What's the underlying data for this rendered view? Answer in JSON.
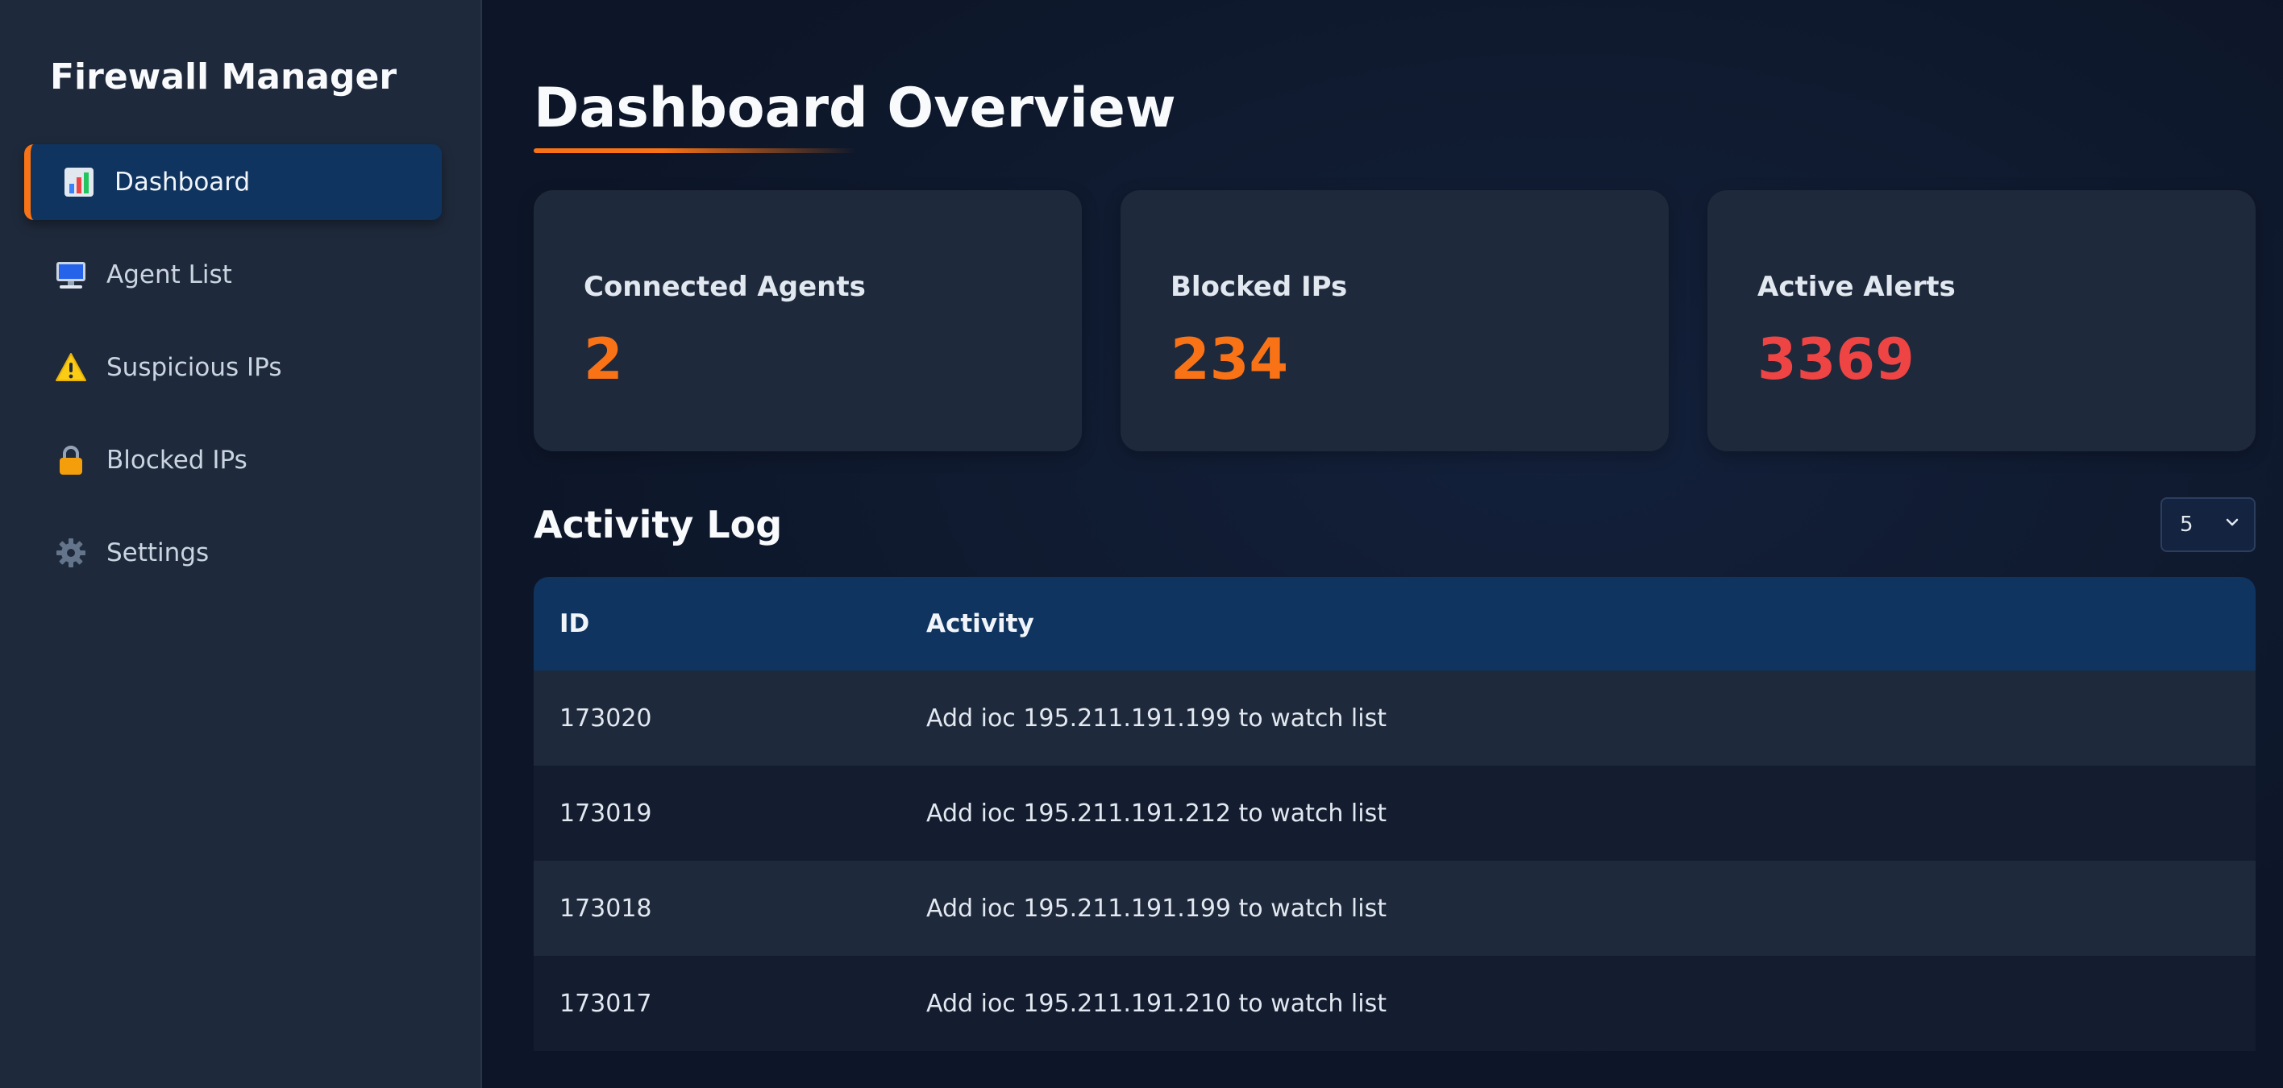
{
  "sidebar": {
    "brand": "Firewall Manager",
    "items": [
      {
        "label": "Dashboard",
        "icon": "bar-chart-icon"
      },
      {
        "label": "Agent List",
        "icon": "monitor-icon"
      },
      {
        "label": "Suspicious IPs",
        "icon": "warning-icon"
      },
      {
        "label": "Blocked IPs",
        "icon": "lock-icon"
      },
      {
        "label": "Settings",
        "icon": "gear-icon"
      }
    ],
    "active_index": 0
  },
  "main": {
    "title": "Dashboard Overview",
    "stats": [
      {
        "label": "Connected Agents",
        "value": "2",
        "color": "#f97316"
      },
      {
        "label": "Blocked IPs",
        "value": "234",
        "color": "#f97316"
      },
      {
        "label": "Active Alerts",
        "value": "3369",
        "color": "#ef4444"
      }
    ],
    "activity_log": {
      "title": "Activity Log",
      "page_size": "5",
      "columns": [
        "ID",
        "Activity"
      ],
      "rows": [
        {
          "id": "173020",
          "activity": "Add ioc 195.211.191.199 to watch list"
        },
        {
          "id": "173019",
          "activity": "Add ioc 195.211.191.212 to watch list"
        },
        {
          "id": "173018",
          "activity": "Add ioc 195.211.191.199 to watch list"
        },
        {
          "id": "173017",
          "activity": "Add ioc 195.211.191.210 to watch list"
        }
      ]
    }
  },
  "colors": {
    "accent": "#f97316",
    "alert": "#ef4444",
    "sidebar_bg": "#1e293b",
    "header_bg": "#0f3460"
  }
}
